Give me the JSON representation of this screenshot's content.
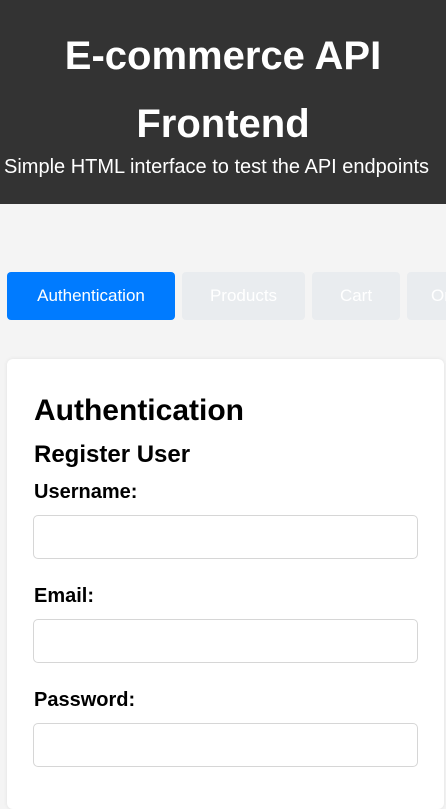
{
  "header": {
    "title": "E-commerce API Frontend",
    "subtitle": "Simple HTML interface to test the API endpoints"
  },
  "tabs": [
    {
      "label": "Authentication",
      "active": true
    },
    {
      "label": "Products",
      "active": false
    },
    {
      "label": "Cart",
      "active": false
    },
    {
      "label": "Orders",
      "active": false
    }
  ],
  "auth": {
    "section_title": "Authentication",
    "register_heading": "Register User",
    "username_label": "Username:",
    "username_value": "",
    "email_label": "Email:",
    "email_value": "",
    "password_label": "Password:",
    "password_value": ""
  },
  "colors": {
    "header_bg": "#333333",
    "accent": "#007bff",
    "tab_inactive_bg": "#e9ecef",
    "page_bg": "#f4f4f4"
  }
}
